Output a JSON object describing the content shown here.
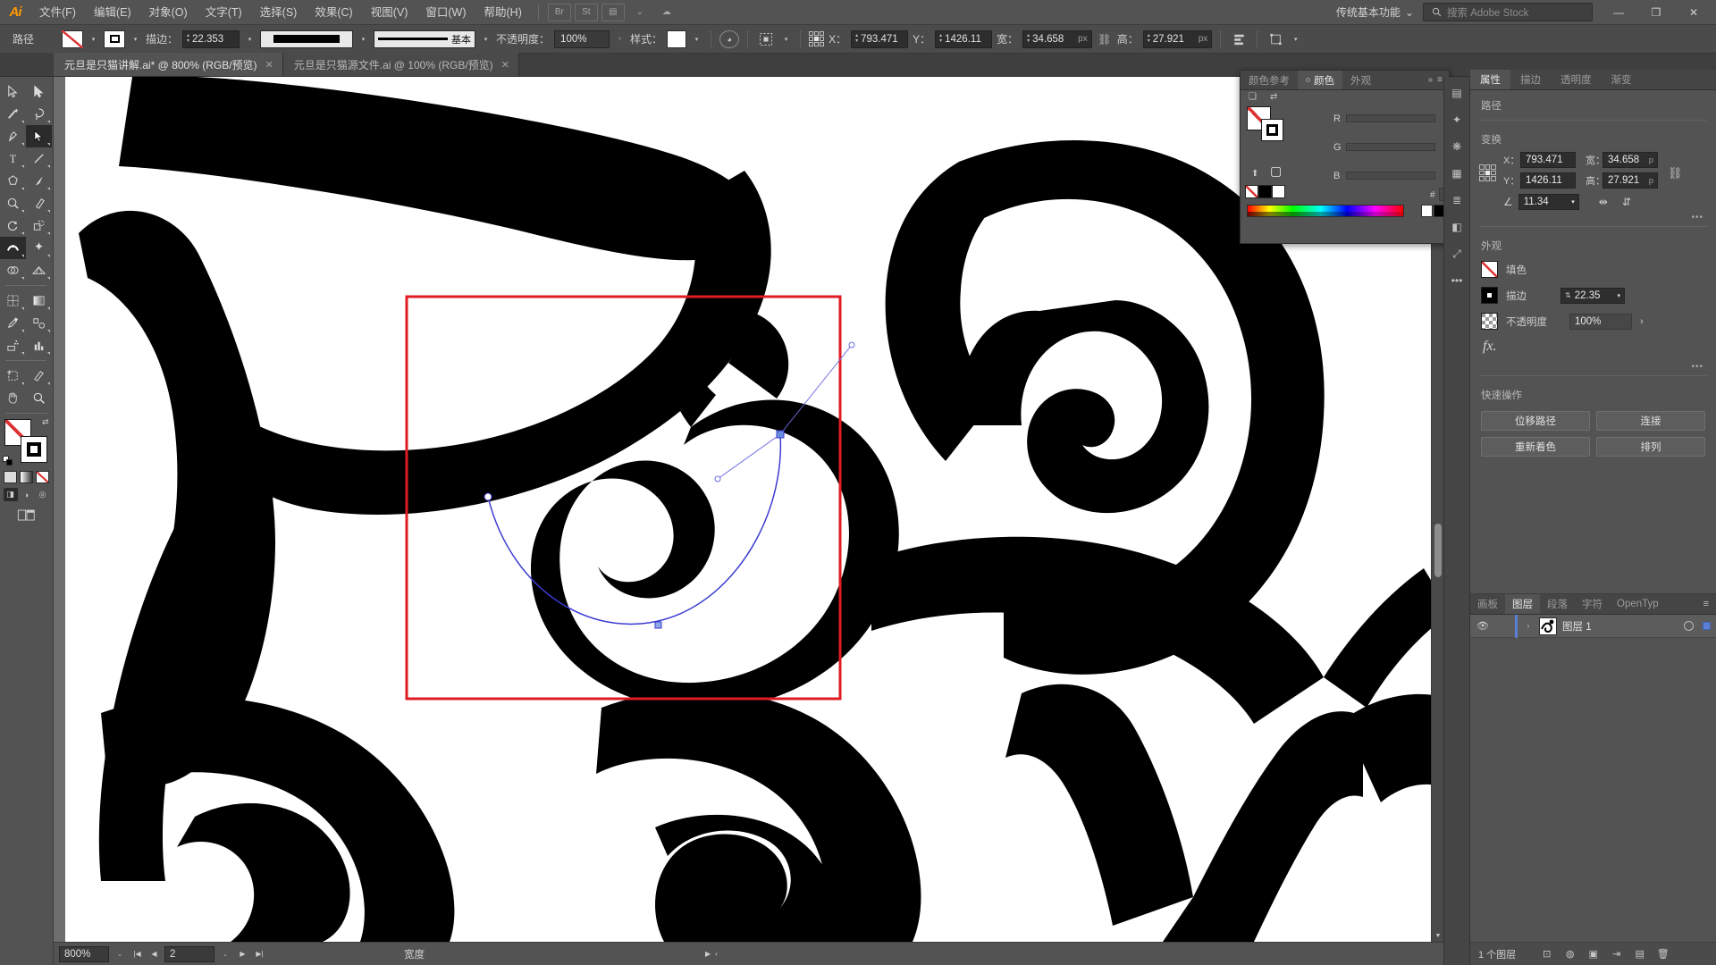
{
  "app": {
    "logo": "Ai"
  },
  "menubar": {
    "items": [
      {
        "label": "文件(F)"
      },
      {
        "label": "编辑(E)"
      },
      {
        "label": "对象(O)"
      },
      {
        "label": "文字(T)"
      },
      {
        "label": "选择(S)"
      },
      {
        "label": "效果(C)"
      },
      {
        "label": "视图(V)"
      },
      {
        "label": "窗口(W)"
      },
      {
        "label": "帮助(H)"
      }
    ],
    "quick_icons": [
      {
        "name": "bridge-icon",
        "glyph": "Br"
      },
      {
        "name": "stock-icon",
        "glyph": "St"
      },
      {
        "name": "arrange-documents-icon",
        "glyph": "▤"
      },
      {
        "name": "arrange-caret-icon",
        "glyph": "⌄"
      },
      {
        "name": "cloud-sync-icon",
        "glyph": "☁"
      }
    ],
    "workspace": {
      "label": "传统基本功能",
      "caret": "⌄"
    },
    "search": {
      "icon": "search-icon",
      "placeholder": "搜索 Adobe Stock"
    },
    "window_buttons": [
      {
        "name": "minimize-button",
        "glyph": "—"
      },
      {
        "name": "maximize-button",
        "glyph": "❐"
      },
      {
        "name": "close-button",
        "glyph": "✕"
      }
    ]
  },
  "controlbar": {
    "object_type": "路径",
    "fill_label_icon": "fill-swatch-none",
    "stroke_label": "描边：",
    "stroke_weight": "22.353",
    "stroke_profile": "基本",
    "opacity_label": "不透明度：",
    "opacity_value": "100%",
    "style_label": "样式：",
    "x_label": "X：",
    "x_value": "793.471",
    "y_label": "Y：",
    "y_value": "1426.11",
    "w_label": "宽：",
    "w_value": "34.658",
    "w_unit": "px",
    "h_label": "高：",
    "h_value": "27.921",
    "h_unit": "px"
  },
  "tabs": [
    {
      "title": "元旦是只猫讲解.ai* @ 800% (RGB/预览)",
      "active": true,
      "close": "✕"
    },
    {
      "title": "元旦是只猫源文件.ai @ 100% (RGB/预览)",
      "active": false,
      "close": "✕"
    }
  ],
  "toolbar": {
    "tools": [
      {
        "name": "selection-tool",
        "glyph": "selection"
      },
      {
        "name": "direct-selection-tool",
        "glyph": "direct"
      },
      {
        "name": "magic-wand-tool",
        "glyph": "wand"
      },
      {
        "name": "lasso-tool",
        "glyph": "lasso"
      },
      {
        "name": "pen-tool",
        "glyph": "pen"
      },
      {
        "name": "curvature-tool",
        "glyph": "curvature"
      },
      {
        "name": "type-tool",
        "glyph": "type"
      },
      {
        "name": "line-segment-tool",
        "glyph": "line"
      },
      {
        "name": "polygon-tool",
        "glyph": "polygon"
      },
      {
        "name": "paintbrush-tool",
        "glyph": "brush"
      },
      {
        "name": "shaper-tool",
        "glyph": "shaper"
      },
      {
        "name": "eraser-tool",
        "glyph": "eraser"
      },
      {
        "name": "rotate-tool",
        "glyph": "rotate"
      },
      {
        "name": "scale-tool",
        "glyph": "scale"
      },
      {
        "name": "width-tool",
        "glyph": "width",
        "selected": true
      },
      {
        "name": "free-transform-tool",
        "glyph": "freetransform"
      },
      {
        "name": "shape-builder-tool",
        "glyph": "shapebuilder"
      },
      {
        "name": "perspective-grid-tool",
        "glyph": "perspective"
      },
      {
        "name": "mesh-tool",
        "glyph": "mesh"
      },
      {
        "name": "gradient-tool",
        "glyph": "gradient"
      },
      {
        "name": "eyedropper-tool",
        "glyph": "eyedropper"
      },
      {
        "name": "blend-tool",
        "glyph": "blend"
      },
      {
        "name": "symbol-sprayer-tool",
        "glyph": "symbol"
      },
      {
        "name": "column-graph-tool",
        "glyph": "graph"
      },
      {
        "name": "artboard-tool",
        "glyph": "artboard"
      },
      {
        "name": "slice-tool",
        "glyph": "slice"
      },
      {
        "name": "hand-tool",
        "glyph": "hand"
      },
      {
        "name": "zoom-tool",
        "glyph": "zoom"
      }
    ],
    "draw_modes": [
      {
        "name": "draw-normal-mode",
        "glyph": "◨",
        "selected": true
      },
      {
        "name": "draw-behind-mode",
        "glyph": "◑"
      },
      {
        "name": "draw-inside-mode",
        "glyph": "◎"
      }
    ],
    "screen_mode": {
      "name": "change-screen-mode",
      "glyph": "▤"
    }
  },
  "color_panel": {
    "tabs": [
      {
        "label": "颜色参考",
        "active": false
      },
      {
        "label": "颜色",
        "active": true
      },
      {
        "label": "外观",
        "active": false
      }
    ],
    "collapse": "»",
    "menu": "≡",
    "channels": [
      {
        "label": "R",
        "value": ""
      },
      {
        "label": "G",
        "value": ""
      },
      {
        "label": "B",
        "value": ""
      }
    ],
    "hex_label": "#",
    "hex_value": ""
  },
  "properties": {
    "tabs": [
      {
        "label": "属性",
        "active": true
      },
      {
        "label": "描边",
        "active": false
      },
      {
        "label": "透明度",
        "active": false
      },
      {
        "label": "渐变",
        "active": false
      }
    ],
    "object_title": "路径",
    "transform": {
      "title": "变换",
      "x_label": "X：",
      "x_value": "793.471",
      "y_label": "Y：",
      "y_value": "1426.11",
      "w_label": "宽：",
      "w_value": "34.658",
      "w_unit": "p",
      "h_label": "高：",
      "h_value": "27.921",
      "h_unit": "p",
      "angle_label": "∠",
      "angle_value": "11.34",
      "flip_h_icon": "flip-horizontal-icon",
      "flip_v_icon": "flip-vertical-icon",
      "more_options": "•••"
    },
    "appearance": {
      "title": "外观",
      "fill_label": "填色",
      "stroke_label": "描边",
      "stroke_value": "22.35",
      "opacity_label": "不透明度",
      "opacity_value": "100%",
      "fx_label": "fx.",
      "more_options": "•••"
    },
    "quick_actions": {
      "title": "快速操作",
      "buttons": [
        {
          "label": "位移路径"
        },
        {
          "label": "连接"
        },
        {
          "label": "重新着色"
        },
        {
          "label": "排列"
        }
      ]
    }
  },
  "layers_panel": {
    "tabs": [
      {
        "label": "画板",
        "active": false
      },
      {
        "label": "图层",
        "active": true
      },
      {
        "label": "段落",
        "active": false
      },
      {
        "label": "字符",
        "active": false
      },
      {
        "label": "OpenTyp",
        "active": false
      }
    ],
    "menu_icon": "≡",
    "rows": [
      {
        "name": "图层 1",
        "visible": true,
        "locked": false,
        "expand": "›",
        "accent": "#5b7fd6"
      }
    ],
    "footer": {
      "count_text": "1 个图层",
      "icons": [
        {
          "name": "locate-object-icon",
          "glyph": "⊡"
        },
        {
          "name": "make-mask-icon",
          "glyph": "◍"
        },
        {
          "name": "new-sublayer-icon",
          "glyph": "▣"
        },
        {
          "name": "collect-export-icon",
          "glyph": "⇥"
        },
        {
          "name": "new-layer-icon",
          "glyph": "▤"
        },
        {
          "name": "delete-layer-icon",
          "glyph": "🗑"
        }
      ]
    }
  },
  "statusbar": {
    "zoom": "800%",
    "zoom_caret": "⌄",
    "nav_first": "|◀",
    "nav_prev": "◀",
    "page": "2",
    "page_caret": "⌄",
    "nav_next": "▶",
    "nav_last": "▶|",
    "tool_text": "宽度",
    "right_arrow": "▶",
    "right_caret": "‹"
  },
  "dock_icons": [
    {
      "name": "libraries-icon",
      "glyph": "▤"
    },
    {
      "name": "brushes-icon",
      "glyph": "✦"
    },
    {
      "name": "symbols-icon",
      "glyph": "❋"
    },
    {
      "name": "swatches-icon",
      "glyph": "▦"
    },
    {
      "name": "align-icon",
      "glyph": "≣"
    },
    {
      "name": "pathfinder-icon",
      "glyph": "◧"
    },
    {
      "name": "transform-icon",
      "glyph": "⤢"
    },
    {
      "name": "more-panels-icon",
      "glyph": "•••"
    }
  ],
  "canvas": {
    "zoom_label": "800%",
    "annotation_rect_color": "#e01b24",
    "path_stroke_color": "#3a3ad0",
    "artwork_fill": "#000000",
    "background": "#ffffff"
  }
}
